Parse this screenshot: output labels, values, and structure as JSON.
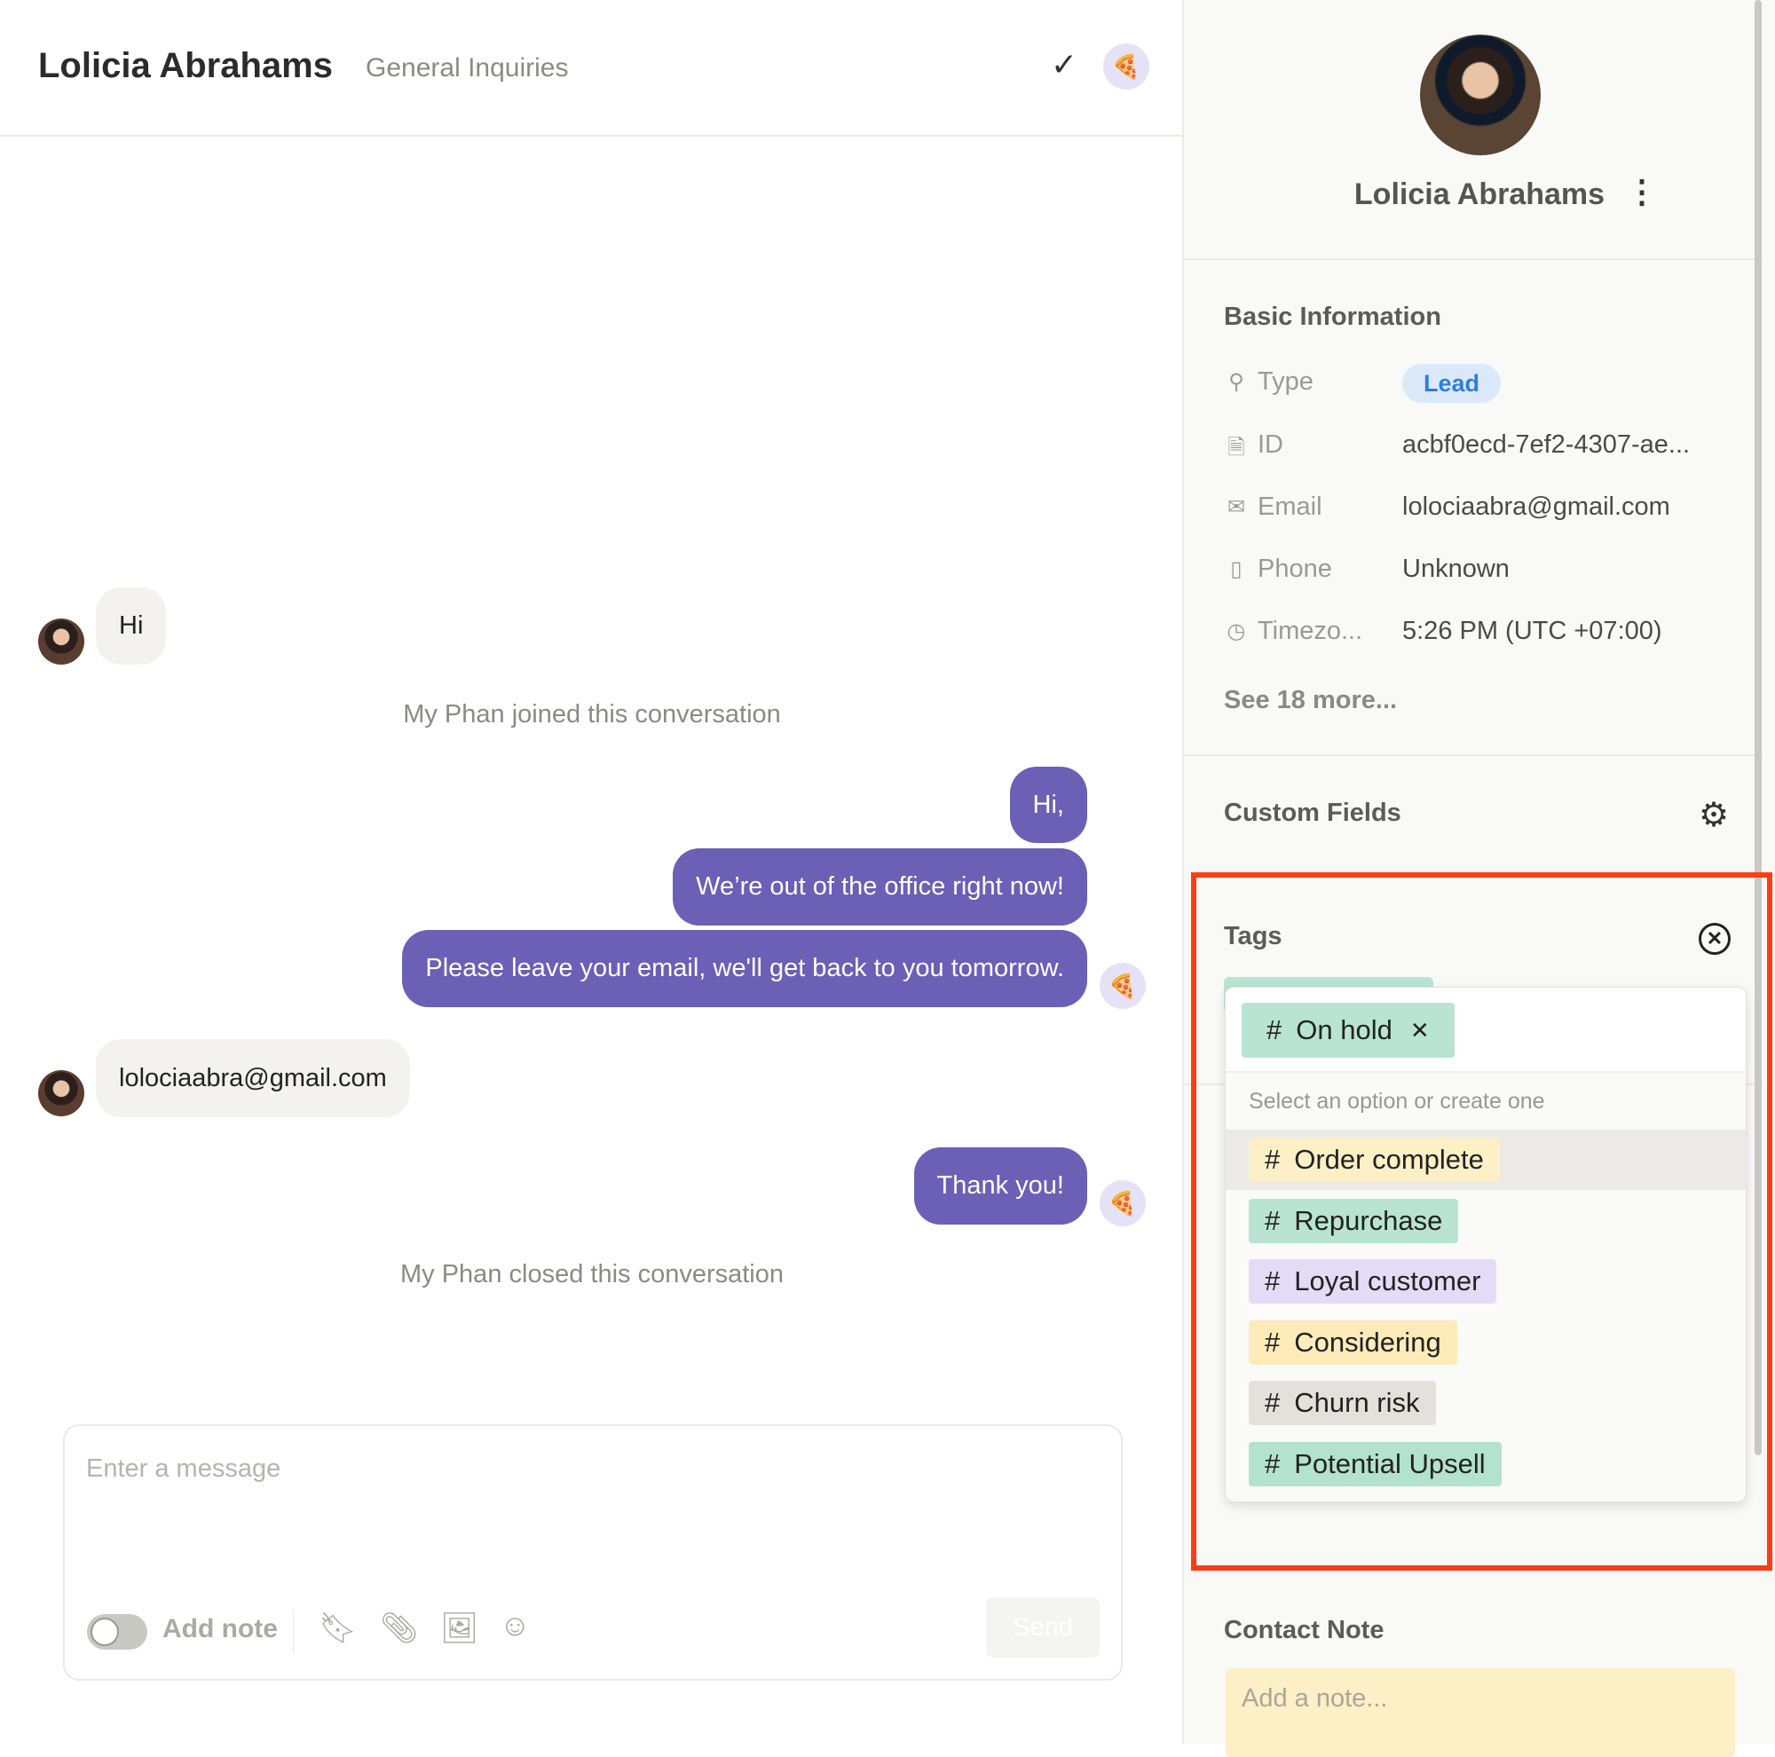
{
  "header": {
    "title": "Lolicia Abrahams",
    "inbox": "General Inquiries"
  },
  "messages": [
    {
      "from": "contact",
      "text": "Hi"
    },
    {
      "from": "system",
      "text": "My Phan joined this conversation"
    },
    {
      "from": "agent",
      "text": "Hi,"
    },
    {
      "from": "agent",
      "text": "We’re out of the office right now!"
    },
    {
      "from": "agent",
      "text": "Please leave your email, we'll get back to you tomorrow."
    },
    {
      "from": "contact",
      "text": "lolociaabra@gmail.com"
    },
    {
      "from": "agent",
      "text": "Thank you!"
    },
    {
      "from": "system",
      "text": "My Phan closed this conversation"
    }
  ],
  "composer": {
    "placeholder": "Enter a message",
    "add_note": "Add note",
    "add_note_on": false,
    "send": "Send"
  },
  "contact": {
    "name": "Lolicia Abrahams",
    "basic_title": "Basic Information",
    "fields": [
      {
        "icon": "person-icon",
        "label": "Type",
        "value": "Lead"
      },
      {
        "icon": "document-icon",
        "label": "ID",
        "value": "acbf0ecd-7ef2-4307-ae..."
      },
      {
        "icon": "mail-icon",
        "label": "Email",
        "value": "lolociaabra@gmail.com"
      },
      {
        "icon": "phone-icon",
        "label": "Phone",
        "value": "Unknown"
      },
      {
        "icon": "clock-icon",
        "label": "Timezo...",
        "value": "5:26 PM (UTC +07:00)"
      }
    ],
    "see_more": "See 18 more...",
    "custom_fields_title": "Custom Fields",
    "tags_title": "Tags",
    "selected_tag": "On hold",
    "tag_placeholder": "Select an option or create one",
    "tag_options": [
      {
        "label": "Order complete",
        "color": "#fdf0c6"
      },
      {
        "label": "Repurchase",
        "color": "#b9e4d3"
      },
      {
        "label": "Loyal customer",
        "color": "#e4dcf6"
      },
      {
        "label": "Considering",
        "color": "#fdecb9"
      },
      {
        "label": "Churn risk",
        "color": "#e3e1dc"
      },
      {
        "label": "Potential Upsell",
        "color": "#b3e2cf"
      }
    ],
    "contact_note_title": "Contact Note",
    "note_placeholder": "Add a note..."
  },
  "colors": {
    "agent_bubble": "#6b5fb6",
    "highlight": "#ff3d14",
    "lead_bg": "#dbe9fb",
    "lead_text": "#2f7de1"
  }
}
